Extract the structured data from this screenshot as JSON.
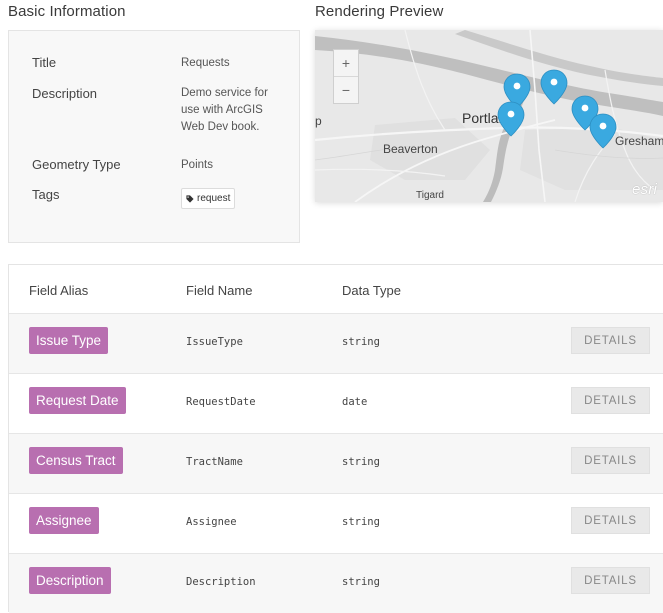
{
  "basic_info": {
    "heading": "Basic Information",
    "rows": [
      {
        "label": "Title",
        "value": "Requests"
      },
      {
        "label": "Description",
        "value_lines": [
          "Demo service for",
          "use with ArcGIS",
          "Web Dev book."
        ]
      },
      {
        "label": "Geometry Type",
        "value": "Points"
      },
      {
        "label": "Tags",
        "tag": "request"
      }
    ]
  },
  "preview": {
    "heading": "Rendering Preview",
    "zoom_in": "+",
    "zoom_out": "−",
    "labels": {
      "portland": "Portland",
      "beaverton": "Beaverton",
      "gresham": "Gresham",
      "tigard": "Tigard",
      "edge_p": "p"
    },
    "attribution": "esri",
    "marker_color": "#3aa9e0",
    "marker_count": 5
  },
  "fields": {
    "headers": {
      "alias": "Field Alias",
      "name": "Field Name",
      "type": "Data Type"
    },
    "details_label": "DETAILS",
    "alias_color": "#b86fb0",
    "rows": [
      {
        "alias": "Issue Type",
        "name": "IssueType",
        "type": "string"
      },
      {
        "alias": "Request Date",
        "name": "RequestDate",
        "type": "date"
      },
      {
        "alias": "Census Tract",
        "name": "TractName",
        "type": "string"
      },
      {
        "alias": "Assignee",
        "name": "Assignee",
        "type": "string"
      },
      {
        "alias": "Description",
        "name": "Description",
        "type": "string"
      }
    ]
  }
}
